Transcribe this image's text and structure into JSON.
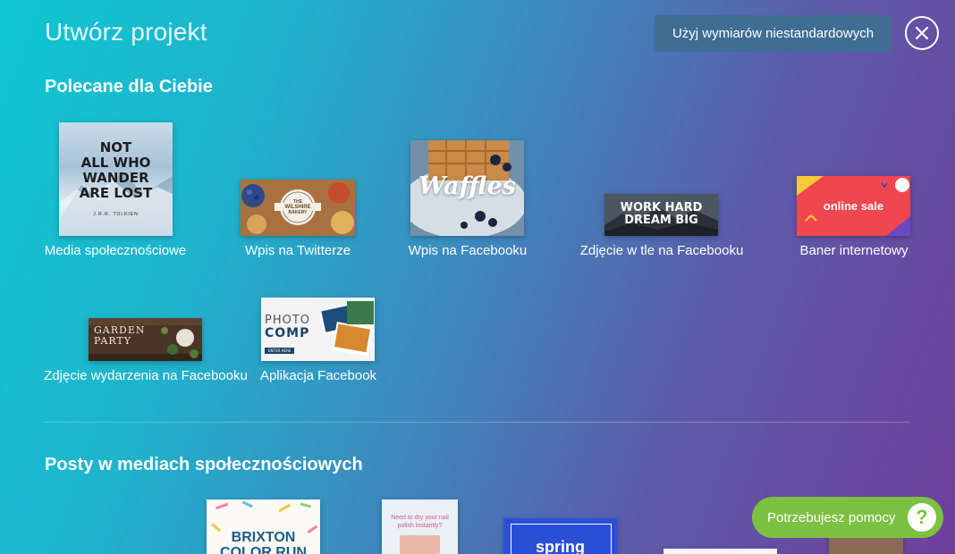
{
  "header": {
    "title": "Utwórz projekt",
    "custom_dimensions_label": "Użyj wymiarów niestandardowych"
  },
  "recommended": {
    "title": "Polecane dla Ciebie",
    "items": [
      {
        "label": "Media społecznościowe",
        "thumb_text": [
          "NOT",
          "ALL WHO",
          "WANDER",
          "ARE LOST"
        ],
        "thumb_caption": "J.R.R. TOLKIEN"
      },
      {
        "label": "Wpis na Twitterze",
        "thumb_text": [
          "THE",
          "WILSHIRE",
          "BAKERY"
        ]
      },
      {
        "label": "Wpis na Facebooku",
        "thumb_text": [
          "Waffles"
        ]
      },
      {
        "label": "Zdjęcie w tle na Facebooku",
        "thumb_text": [
          "WORK HARD",
          "DREAM BIG"
        ]
      },
      {
        "label": "Baner internetowy",
        "thumb_text": [
          "online sale"
        ]
      },
      {
        "label": "Zdjęcie wydarzenia na Facebooku",
        "thumb_text": [
          "GARDEN",
          "PARTY"
        ]
      },
      {
        "label": "Aplikacja Facebook",
        "thumb_text": [
          "PHOTO",
          "COMP",
          "ENTER HERE"
        ]
      }
    ]
  },
  "social": {
    "title": "Posty w mediach społecznościowych",
    "items": [
      {
        "thumb_text": [
          "BRIXTON",
          "COLOR RUN"
        ]
      },
      {
        "thumb_text": [
          "Need to dry your nail",
          "polish instantly?"
        ]
      },
      {
        "thumb_text": [
          "spring"
        ]
      },
      {
        "thumb_text": []
      },
      {
        "thumb_text": []
      }
    ]
  },
  "help": {
    "label": "Potrzebujesz pomocy",
    "icon_glyph": "?"
  },
  "colors": {
    "help_green": "#7dc142",
    "custom_btn": "#3f6d94"
  }
}
